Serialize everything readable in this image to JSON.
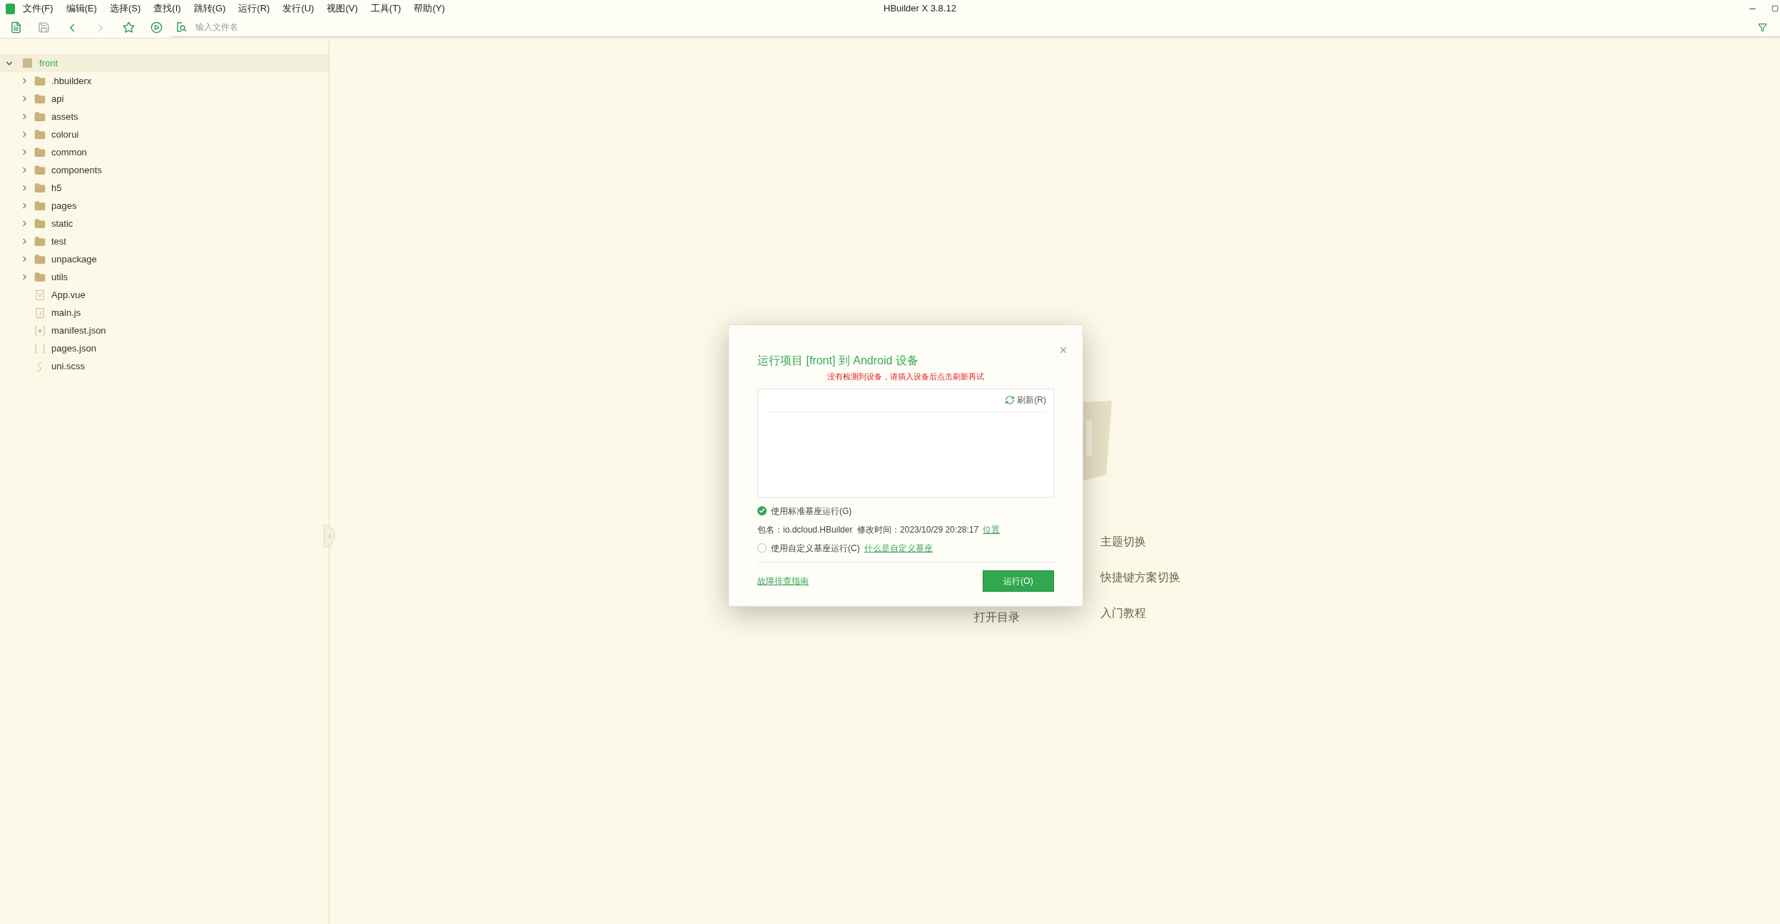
{
  "window": {
    "title": "HBuilder X 3.8.12"
  },
  "menu": [
    "文件(F)",
    "编辑(E)",
    "选择(S)",
    "查找(I)",
    "跳转(G)",
    "运行(R)",
    "发行(U)",
    "视图(V)",
    "工具(T)",
    "帮助(Y)"
  ],
  "toolbar": {
    "search": {
      "placeholder": "输入文件名"
    }
  },
  "project": {
    "name": "front",
    "expanded": true,
    "selected": true,
    "children": [
      {
        "name": ".hbuilderx",
        "kind": "folder",
        "expanded": false
      },
      {
        "name": "api",
        "kind": "folder",
        "expanded": false
      },
      {
        "name": "assets",
        "kind": "folder",
        "expanded": false
      },
      {
        "name": "colorui",
        "kind": "folder",
        "expanded": false
      },
      {
        "name": "common",
        "kind": "folder",
        "expanded": false
      },
      {
        "name": "components",
        "kind": "folder",
        "expanded": false
      },
      {
        "name": "h5",
        "kind": "folder",
        "expanded": false
      },
      {
        "name": "pages",
        "kind": "folder",
        "expanded": false
      },
      {
        "name": "static",
        "kind": "folder",
        "expanded": false
      },
      {
        "name": "test",
        "kind": "folder",
        "expanded": false
      },
      {
        "name": "unpackage",
        "kind": "folder",
        "expanded": false
      },
      {
        "name": "utils",
        "kind": "folder",
        "expanded": false
      },
      {
        "name": "App.vue",
        "kind": "vue"
      },
      {
        "name": "main.js",
        "kind": "js"
      },
      {
        "name": "manifest.json",
        "kind": "manifest"
      },
      {
        "name": "pages.json",
        "kind": "json"
      },
      {
        "name": "uni.scss",
        "kind": "scss"
      }
    ]
  },
  "welcome": {
    "left": [
      "打开目录"
    ],
    "right": [
      "主题切换",
      "快捷键方案切换",
      "入门教程"
    ]
  },
  "dialog": {
    "title": "运行项目 [front] 到 Android 设备",
    "message": "没有检测到设备，请插入设备后点击刷新再试",
    "refresh": "刷新(R)",
    "options": [
      {
        "label": "使用标准基座运行(G)",
        "selected": true
      },
      {
        "label": "使用自定义基座运行(C)",
        "selected": false,
        "link": "什么是自定义基座"
      }
    ],
    "package_info": "包名：io.dcloud.HBuilder  修改时间：2023/10/29 20:28:17",
    "package_link": "位置",
    "guide_link": "故障排查指南",
    "run_button": "运行(O)"
  }
}
